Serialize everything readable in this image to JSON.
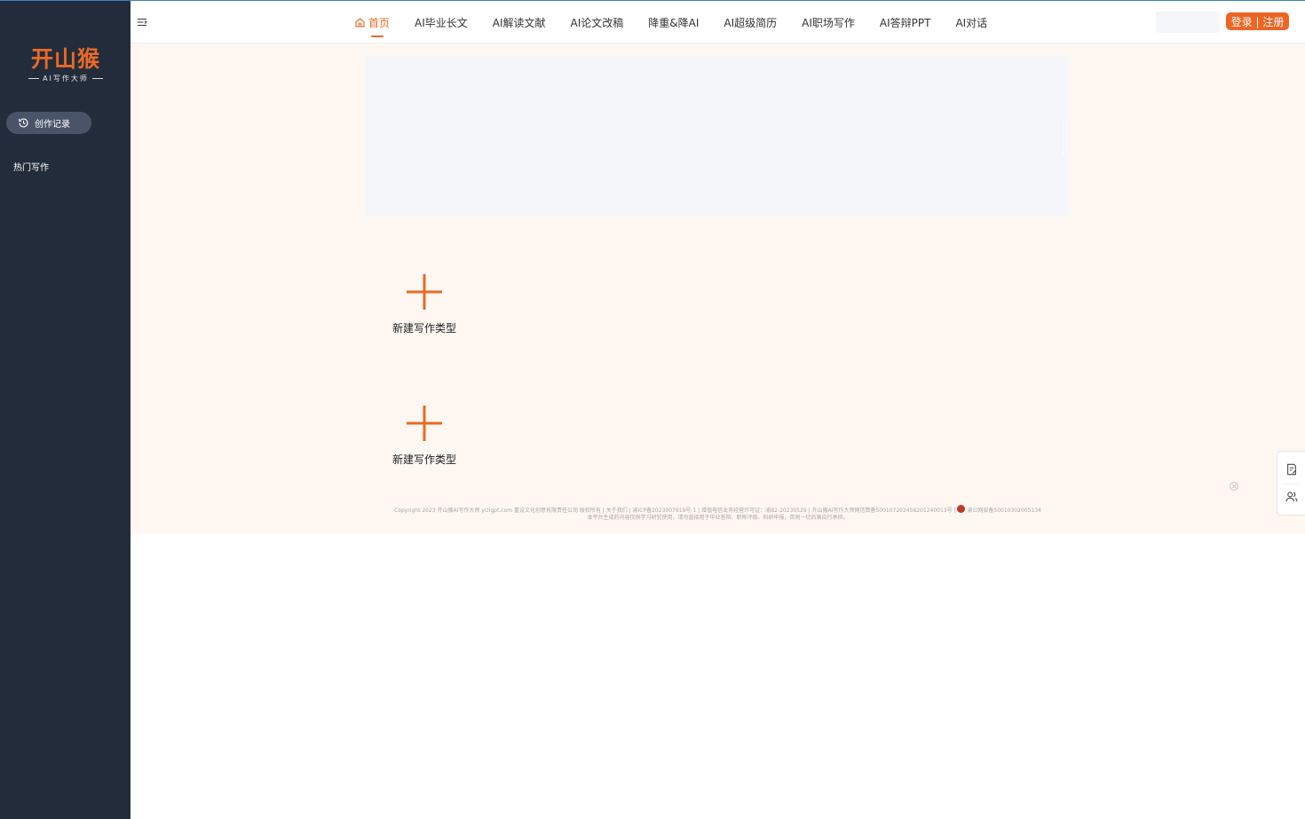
{
  "sidebar": {
    "logo_main": "开山猴",
    "logo_sub": "AI写作大师",
    "record_button": "创作记录",
    "hot_label": "热门写作"
  },
  "header": {
    "nav": [
      {
        "label": "首页",
        "icon": "home-icon",
        "active": true
      },
      {
        "label": "AI毕业长文"
      },
      {
        "label": "AI解读文献"
      },
      {
        "label": "AI论文改稿"
      },
      {
        "label": "降重&降AI"
      },
      {
        "label": "AI超级简历"
      },
      {
        "label": "AI职场写作"
      },
      {
        "label": "AI答辩PPT"
      },
      {
        "label": "AI对话"
      }
    ],
    "search_placeholder": "",
    "login_label": "登录 | 注册"
  },
  "main": {
    "cards": [
      {
        "label": "新建写作类型"
      },
      {
        "label": "新建写作类型"
      }
    ]
  },
  "footer": {
    "line1": "Copyright 2023 开山猴AI写作大师 yizigpt.com 重设文化创意有限责任公司 版权所有 | 关于我们 | 渝ICP备2023007919号-1 | 增值电信业务经营许可证：渝B2-20230529 | 开山猴AI写作大师网信算备500107202456201240013号 |",
    "line1_tail": "渝公网安备50010302005134",
    "line2": "本平台生成的内容仅供学习研究使用，请勿直接用于毕业答辩、职称评级、科研申报，否则一切后果自行承担。"
  },
  "colors": {
    "accent": "#ea6a25",
    "sidebar_bg": "#232c3b",
    "main_bg": "#fef7f2"
  },
  "icons": {
    "menu_toggle": "menu-collapse-icon",
    "record": "history-icon",
    "float_top": "document-edit-icon",
    "float_bottom": "users-icon",
    "close": "close-circle-icon"
  }
}
